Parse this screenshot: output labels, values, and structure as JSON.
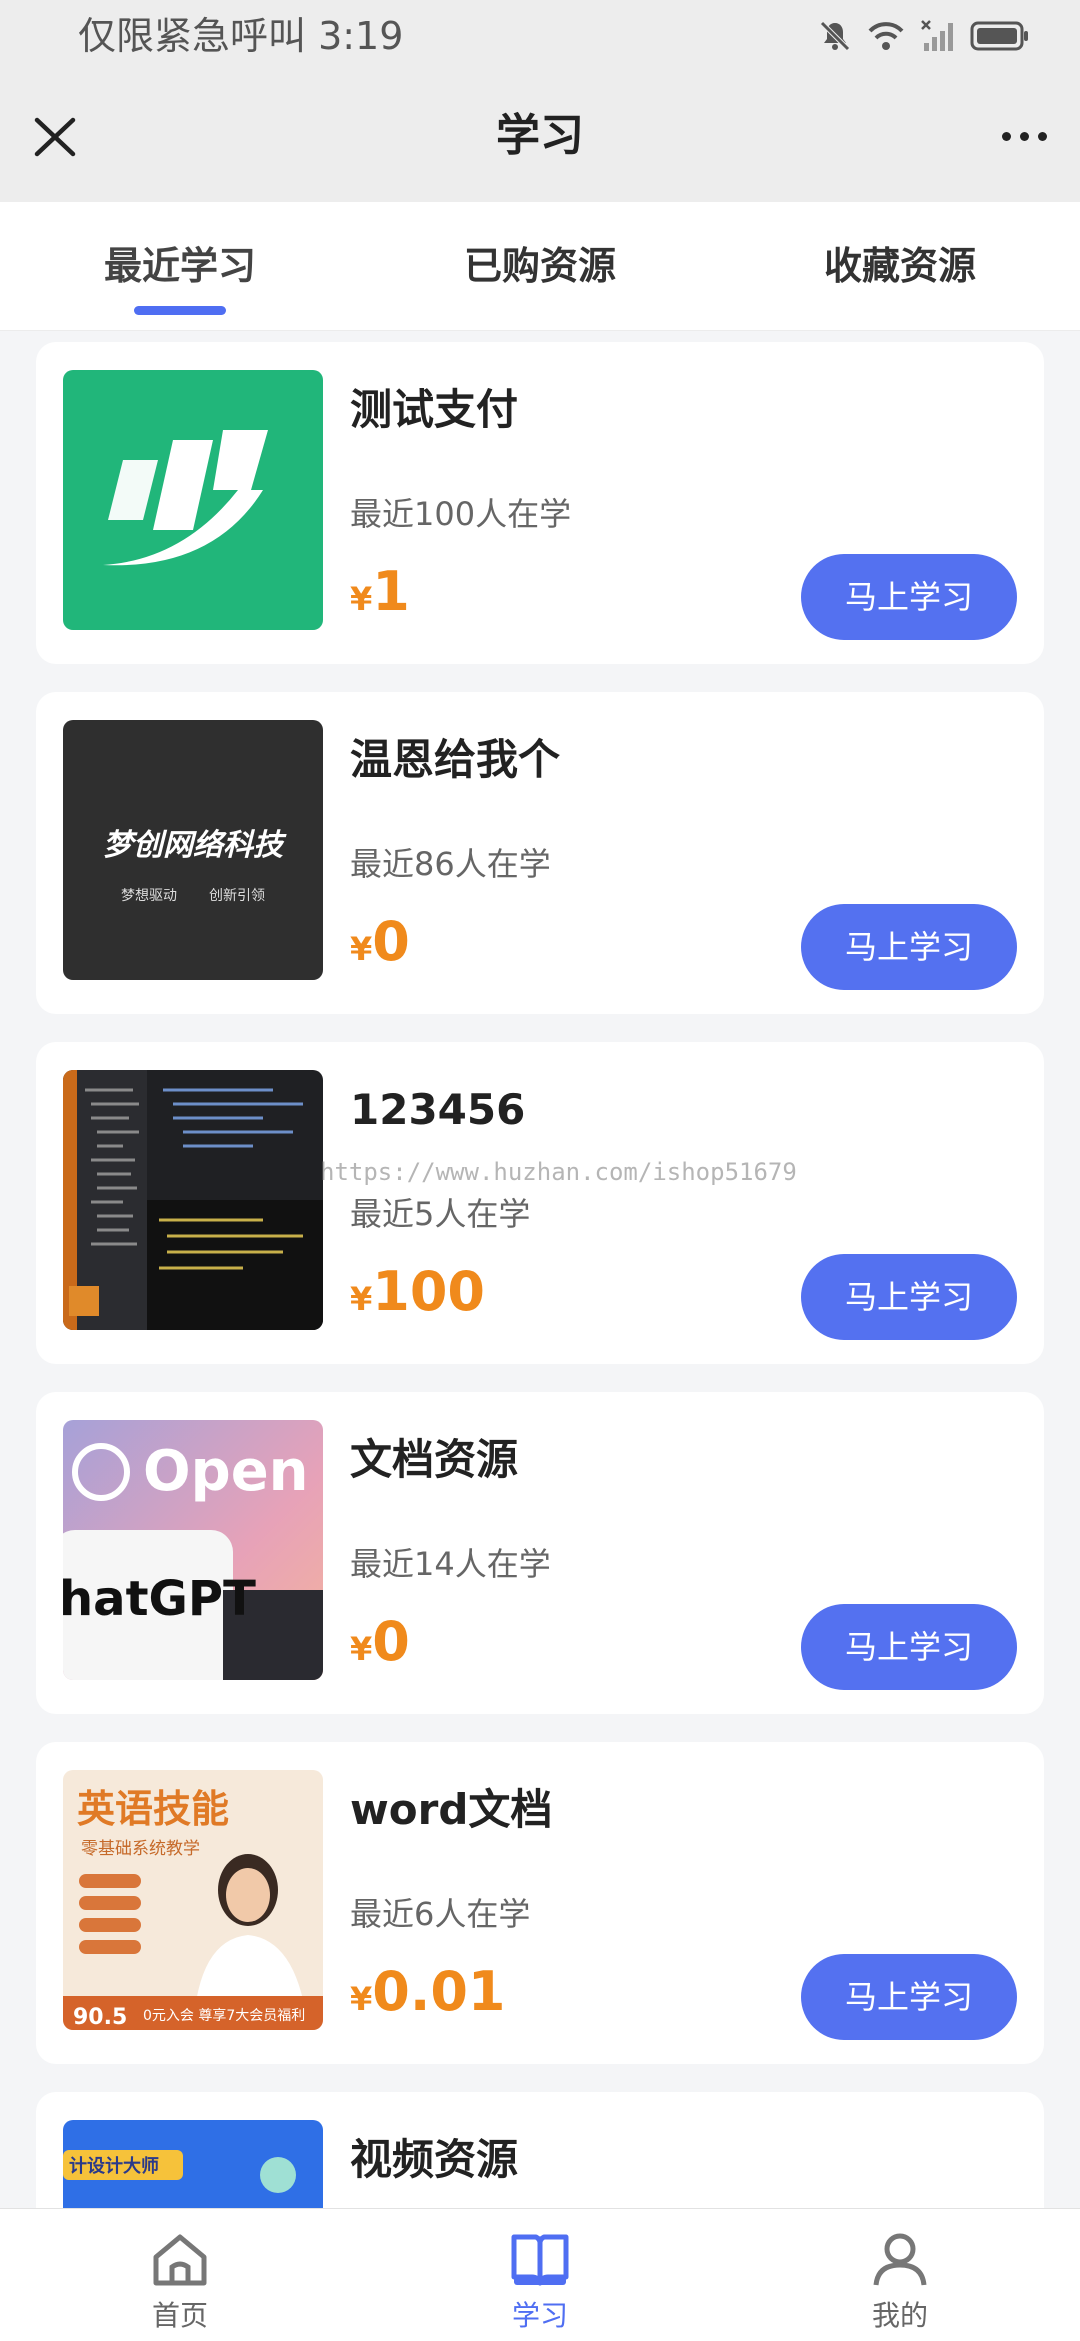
{
  "status_bar": {
    "text": "仅限紧急呼叫 3:19",
    "icons": [
      "bell-muted-icon",
      "wifi-icon",
      "signal-icon",
      "battery-icon"
    ]
  },
  "header": {
    "title": "学习",
    "close_icon": "close-icon",
    "more_icon": "more-icon"
  },
  "tabs": [
    {
      "label": "最近学习",
      "active": true
    },
    {
      "label": "已购资源",
      "active": false
    },
    {
      "label": "收藏资源",
      "active": false
    }
  ],
  "thumb_texts": {
    "dream_title": "梦创网络科技",
    "dream_sub_left": "梦想驱动",
    "dream_sub_right": "创新引领",
    "open_word": "Open",
    "chatgpt_word": "hatGPT",
    "english_title": "英语技能",
    "english_sub": "零基础系统教学",
    "english_price": "90.5",
    "english_footer": "0元入会 尊享7大会员福利",
    "video_banner": "计设计大师"
  },
  "items": [
    {
      "title": "测试支付",
      "learners": "最近100人在学",
      "currency": "¥",
      "price": "1",
      "button": "马上学习"
    },
    {
      "title": "温恩给我个",
      "learners": "最近86人在学",
      "currency": "¥",
      "price": "0",
      "button": "马上学习"
    },
    {
      "title": "123456",
      "learners": "最近5人在学",
      "currency": "¥",
      "price": "100",
      "button": "马上学习"
    },
    {
      "title": "文档资源",
      "learners": "最近14人在学",
      "currency": "¥",
      "price": "0",
      "button": "马上学习"
    },
    {
      "title": "word文档",
      "learners": "最近6人在学",
      "currency": "¥",
      "price": "0.01",
      "button": "马上学习"
    },
    {
      "title": "视频资源",
      "learners": "",
      "currency": "",
      "price": "",
      "button": ""
    }
  ],
  "watermark": "https://www.huzhan.com/ishop51679",
  "bottom_nav": [
    {
      "label": "首页",
      "icon": "home-icon",
      "active": false
    },
    {
      "label": "学习",
      "icon": "book-icon",
      "active": true
    },
    {
      "label": "我的",
      "icon": "user-icon",
      "active": false
    }
  ],
  "colors": {
    "accent": "#5471f0",
    "price": "#f08a1c",
    "header_bg": "#ededed",
    "page_bg": "#f4f5f7"
  }
}
